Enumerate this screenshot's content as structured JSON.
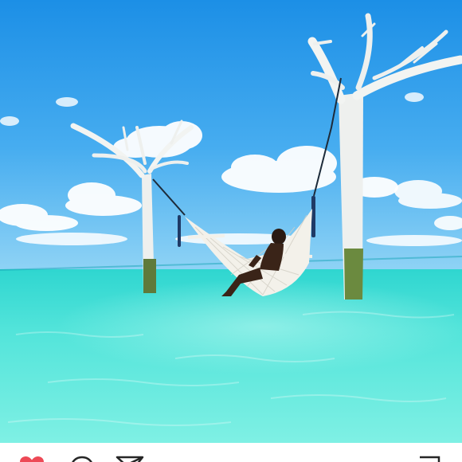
{
  "post": {
    "photo": {
      "subject": "person-in-hammock-over-lagoon"
    },
    "actions": {
      "like_icon": "heart-icon",
      "like_color": "#ed4956",
      "comment_icon": "comment-icon",
      "share_icon": "share-icon",
      "save_icon": "bookmark-icon"
    }
  }
}
